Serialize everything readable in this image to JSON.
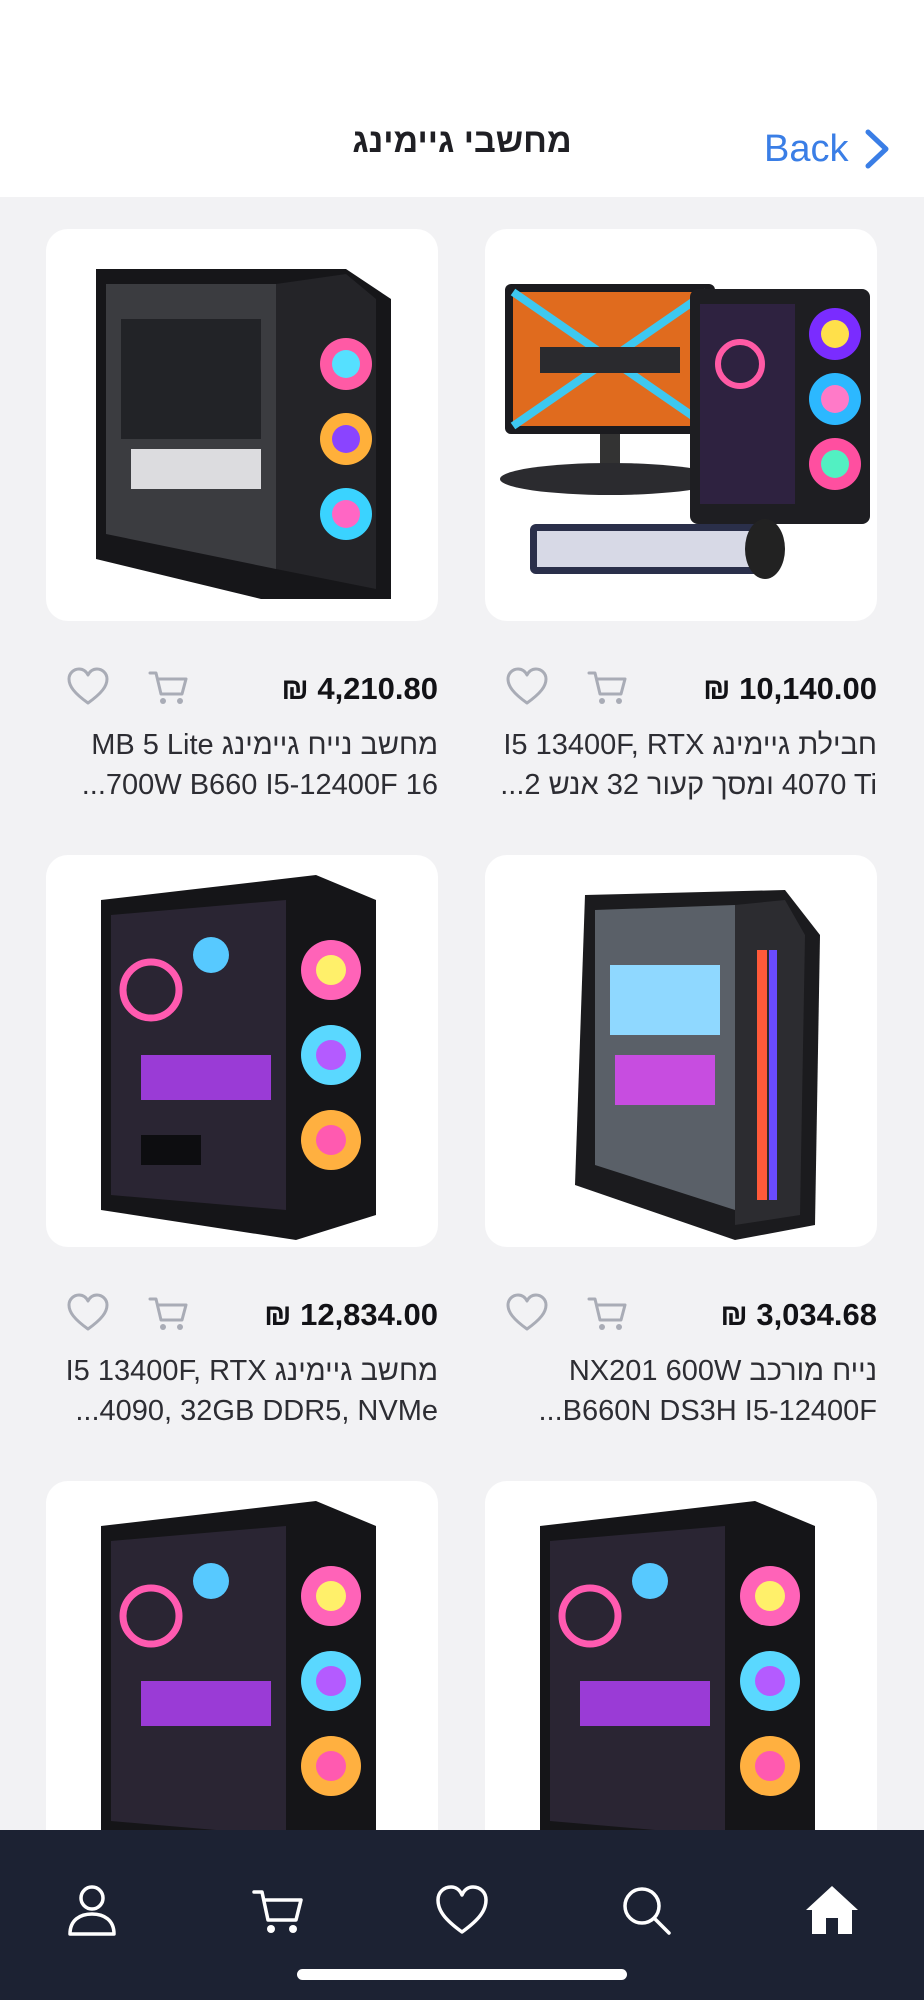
{
  "header": {
    "title": "מחשבי גיימינג",
    "back_label": "Back"
  },
  "products": [
    {
      "price": "₪ 10,140.00",
      "title": "חבילת גיימינג I5 13400F, RTX 4070 Ti ומסך קעור 32 אנש 2...",
      "image_icon": "gaming-bundle-image"
    },
    {
      "price": "₪ 4,210.80",
      "title": "מחשב נייח גיימינג MB 5 Lite 700W B660 I5-12400F 16...",
      "image_icon": "pc-case-image"
    },
    {
      "price": "₪ 3,034.68",
      "title": "נייח מורכב NX201 600W B660N DS3H I5-12400F...",
      "image_icon": "pc-case-image"
    },
    {
      "price": "₪ 12,834.00",
      "title": "מחשב גיימינג I5 13400F, RTX 4090, 32GB DDR5, NVMe...",
      "image_icon": "pc-case-image"
    },
    {
      "price": "",
      "title": "",
      "image_icon": "pc-case-image"
    },
    {
      "price": "",
      "title": "",
      "image_icon": "pc-case-image"
    }
  ],
  "bottom_nav": [
    {
      "icon": "profile-icon"
    },
    {
      "icon": "cart-icon"
    },
    {
      "icon": "heart-icon"
    },
    {
      "icon": "search-icon"
    },
    {
      "icon": "home-icon"
    }
  ],
  "colors": {
    "accent": "#3a7ee6",
    "nav_background": "#1c2233",
    "page_background": "#f2f2f4",
    "icon_gray": "#a9acb6"
  }
}
